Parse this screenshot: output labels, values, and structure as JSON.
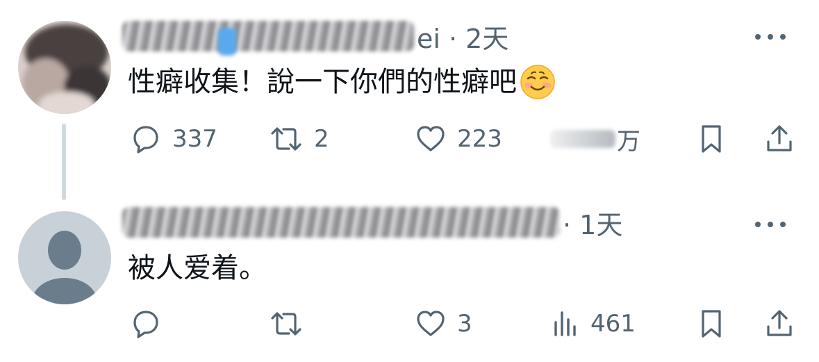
{
  "posts": [
    {
      "meta": "ei · 2天",
      "text": "性癖收集！說一下你們的性癖吧",
      "emoji": "smiling-face-icon",
      "actions": {
        "replies": "337",
        "reposts": "2",
        "likes": "223",
        "views_suffix": "万"
      }
    },
    {
      "meta": "· 1天",
      "text": "被人爱着。",
      "actions": {
        "replies": "",
        "reposts": "",
        "likes": "3",
        "views": "461"
      }
    }
  ],
  "colors": {
    "text": "#0f1419",
    "muted": "#536471",
    "thread_line": "#cfd9de",
    "default_avatar_bg": "#c8d0d8",
    "default_avatar_fg": "#6b7c8c"
  }
}
